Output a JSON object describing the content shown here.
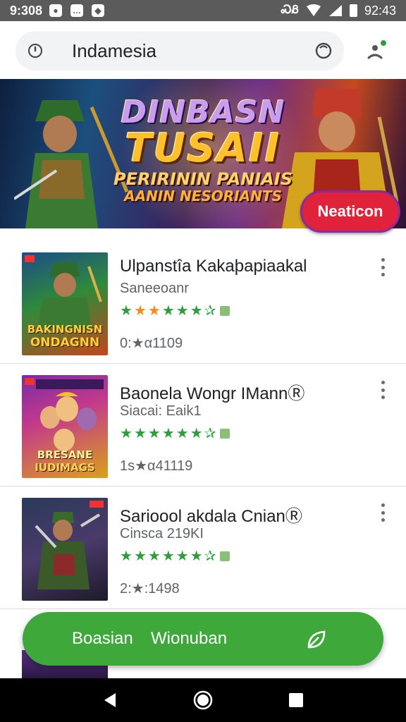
{
  "status_bar": {
    "time": "9:308",
    "notification_icons": [
      "record-icon",
      "chat-icon",
      "shield-icon"
    ],
    "signal_text": "ᏍᏰ",
    "battery_text": "92:43"
  },
  "search": {
    "text": "Indamesia"
  },
  "banner": {
    "line1": "DINBASN",
    "line2": "TUSAII",
    "line3": "PERIRININ PANIAIS",
    "line4": "AANIN NESORIANTS",
    "button_label": "Neaticon"
  },
  "apps": [
    {
      "title": "Ulpanstîa Kakaþapiaakal",
      "subtitle": "Saneeoanr",
      "meta": "0:★α1109",
      "stars": [
        "green",
        "orange",
        "orange",
        "green",
        "green",
        "green",
        "green"
      ],
      "thumb_caption_1": "BAKINGNISN",
      "thumb_caption_2": "ONDAGNN"
    },
    {
      "title": "Baonela Wongr IMannⓇ",
      "subtitle": "Siacai: Eaik1",
      "meta": "1s★α41119",
      "stars": [
        "green",
        "green",
        "green",
        "green",
        "green",
        "green",
        "green"
      ],
      "thumb_caption_1": "BRESANE",
      "thumb_caption_2": "IUDIMAGS"
    },
    {
      "title": "Sarioool akdala CnianⓇ",
      "subtitle": "Cinsca 219KI",
      "meta": "2:★:1498",
      "stars": [
        "green",
        "green",
        "green",
        "green",
        "green",
        "green",
        "green"
      ],
      "thumb_caption_1": "",
      "thumb_caption_2": ""
    }
  ],
  "floating_bar": {
    "left_label": "Boasian",
    "right_label": "Wionuban",
    "icon": "leaf-icon",
    "color": "#3ea83a"
  },
  "colors": {
    "accent_green": "#3ea83a",
    "banner_button": "#e0233a",
    "star_green": "#2e9e3d",
    "star_orange": "#f28c1b"
  }
}
